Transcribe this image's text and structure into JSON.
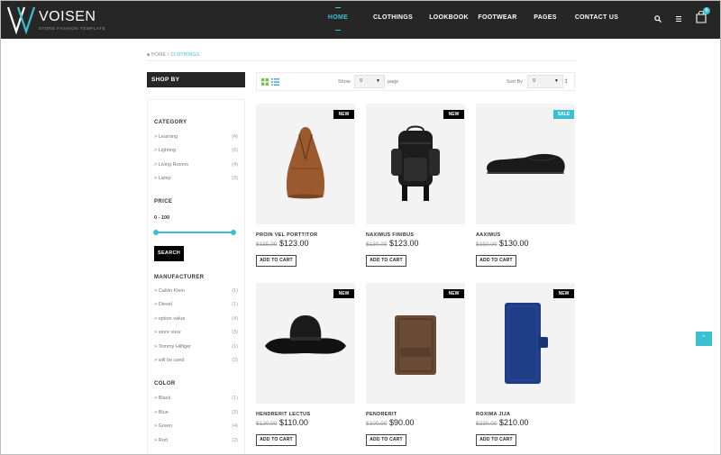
{
  "brand": {
    "name": "VOISEN",
    "tagline": "STORE FASHION TEMPLATE"
  },
  "nav": [
    "HOME",
    "CLOTHINGS",
    "LOOKBOOK",
    "FOOTWEAR",
    "PAGES",
    "CONTACT US"
  ],
  "header": {
    "cart_count": "0"
  },
  "breadcrumb": {
    "home": "HOME",
    "sep": "/",
    "current": "CLOTHINGS"
  },
  "sidebar": {
    "title": "SHOP BY",
    "category": {
      "title": "CATEGORY",
      "items": [
        {
          "label": "> Learning",
          "count": "(4)"
        },
        {
          "label": "> Lighting",
          "count": "(6)"
        },
        {
          "label": "> Living Rooms",
          "count": "(4)"
        },
        {
          "label": "> Lamp",
          "count": "(3)"
        }
      ]
    },
    "price": {
      "title": "PRICE",
      "range": "0 - 100",
      "search": "SEARCH"
    },
    "manufacturer": {
      "title": "MANUFACTURER",
      "items": [
        {
          "label": "> Calvin Klein",
          "count": "(1)"
        },
        {
          "label": "> Diesel",
          "count": "(1)"
        },
        {
          "label": "> option value",
          "count": "(4)"
        },
        {
          "label": "> store view",
          "count": "(3)"
        },
        {
          "label": "> Tommy Hilfiger",
          "count": "(1)"
        },
        {
          "label": "> will be used",
          "count": "(2)"
        }
      ]
    },
    "color": {
      "title": "COLOR",
      "items": [
        {
          "label": "> Black",
          "count": "(1)"
        },
        {
          "label": "> Blue",
          "count": "(3)"
        },
        {
          "label": "> Green",
          "count": "(4)"
        },
        {
          "label": "> Red",
          "count": "(2)"
        }
      ]
    }
  },
  "toolbar": {
    "show_label": "Show",
    "show_value": "9",
    "page_label": "page",
    "sort_label": "Sort By",
    "sort_value": "9"
  },
  "products": [
    {
      "name": "PROIN VEL PORTTITOR",
      "old_price": "$155.00",
      "price": "$123.00",
      "badge": "NEW",
      "button": "ADD TO CART"
    },
    {
      "name": "NAXIMUS FINIBUS",
      "old_price": "$130.00",
      "price": "$123.00",
      "badge": "NEW",
      "button": "ADD TO CART"
    },
    {
      "name": "AAXIMUS",
      "old_price": "$150.00",
      "price": "$130.00",
      "badge": "SALE",
      "button": "ADD TO CART"
    },
    {
      "name": "HENDRERIT LECTUS",
      "old_price": "$120.00",
      "price": "$110.00",
      "badge": "NEW",
      "button": "ADD TO CART"
    },
    {
      "name": "PENDRERIT",
      "old_price": "$100.00",
      "price": "$90.00",
      "badge": "NEW",
      "button": "ADD TO CART"
    },
    {
      "name": "ROXIMA JIJA",
      "old_price": "$230.00",
      "price": "$210.00",
      "badge": "NEW",
      "button": "ADD TO CART"
    }
  ],
  "colors": {
    "accent": "#3cc0d0",
    "header_bg": "#262626",
    "image_bg": "#f3f3f3"
  }
}
